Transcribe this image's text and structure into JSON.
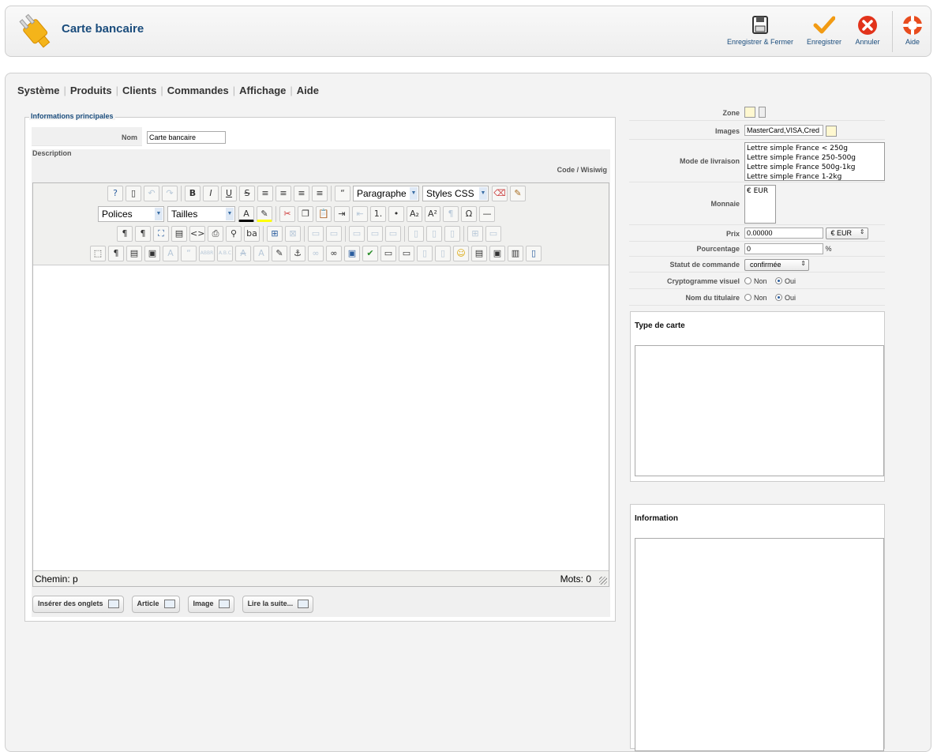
{
  "header": {
    "title": "Carte bancaire",
    "buttons": [
      {
        "label": "Enregistrer & Fermer",
        "icon": "save-icon"
      },
      {
        "label": "Enregistrer",
        "icon": "checkmark-icon"
      },
      {
        "label": "Annuler",
        "icon": "cancel-icon"
      },
      {
        "label": "Aide",
        "icon": "help-lifebuoy-icon"
      }
    ]
  },
  "menu": [
    "Système",
    "Produits",
    "Clients",
    "Commandes",
    "Affichage",
    "Aide"
  ],
  "form": {
    "legend": "Informations principales",
    "nom_label": "Nom",
    "nom_value": "Carte bancaire",
    "description_label": "Description",
    "code_toggle": "Code / Wisiwig",
    "editor": {
      "format_select": "Paragraphe",
      "styles_select": "Styles CSS",
      "font_select": "Polices",
      "size_select": "Tailles",
      "path": "Chemin: p",
      "words": "Mots: 0"
    },
    "editor_buttons": [
      "Insérer des onglets",
      "Article",
      "Image",
      "Lire la suite..."
    ]
  },
  "right": {
    "zone_label": "Zone",
    "images_label": "Images",
    "images_value": "MasterCard,VISA,Cred",
    "livraison_label": "Mode de livraison",
    "livraison_options": [
      "Lettre simple France < 250g",
      "Lettre simple France 250-500g",
      "Lettre simple France 500g-1kg",
      "Lettre simple France 1-2kg"
    ],
    "monnaie_label": "Monnaie",
    "monnaie_options": [
      "€ EUR"
    ],
    "prix_label": "Prix",
    "prix_value": "0.00000",
    "prix_currency": "€ EUR",
    "pourcentage_label": "Pourcentage",
    "pourcentage_value": "0",
    "pourcentage_unit": "%",
    "statut_label": "Statut de commande",
    "statut_value": "confirmée",
    "crypto_label": "Cryptogramme visuel",
    "titulaire_label": "Nom du titulaire",
    "radio_non": "Non",
    "radio_oui": "Oui",
    "type_carte_title": "Type de carte",
    "information_title": "Information"
  }
}
